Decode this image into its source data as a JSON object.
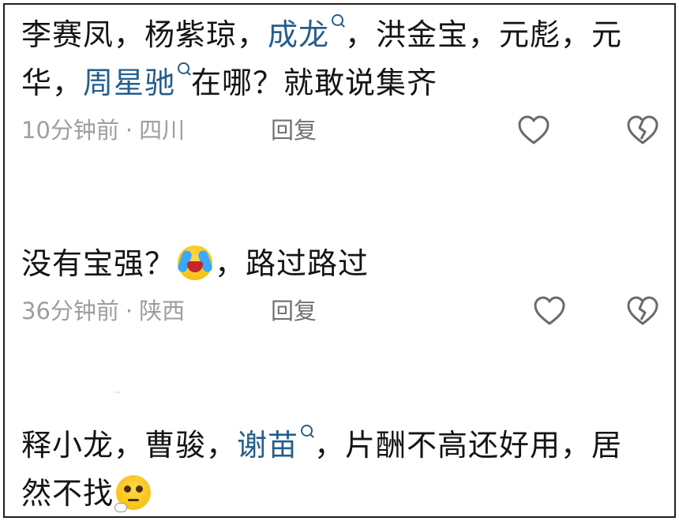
{
  "comments": [
    {
      "text_before": "李赛凤，杨紫琼，",
      "mention1": "成龙",
      "text_middle": "，洪金宝，元彪，元华，",
      "mention2": "周星驰",
      "text_after": "在哪？就敢说集齐",
      "time": "10分钟前",
      "separator": "·",
      "location": "四川",
      "reply_label": "回复"
    },
    {
      "text_before": "没有宝强？",
      "emoji": "crying-laughing-emoji",
      "text_after": "，路过路过",
      "time": "36分钟前",
      "separator": "·",
      "location": "陕西",
      "reply_label": "回复"
    },
    {
      "text_before": "释小龙，曹骏，",
      "mention1": "谢苗",
      "text_after": "，片酬不高还好用，居然不找",
      "emoji": "pleading-face-emoji"
    }
  ],
  "icons": {
    "like": "heart-outline-icon",
    "dislike": "broken-heart-outline-icon",
    "mention_search": "search-icon"
  },
  "colors": {
    "text": "#141414",
    "mention": "#255e8c",
    "meta": "#9e9e9e",
    "reply": "#707070"
  }
}
